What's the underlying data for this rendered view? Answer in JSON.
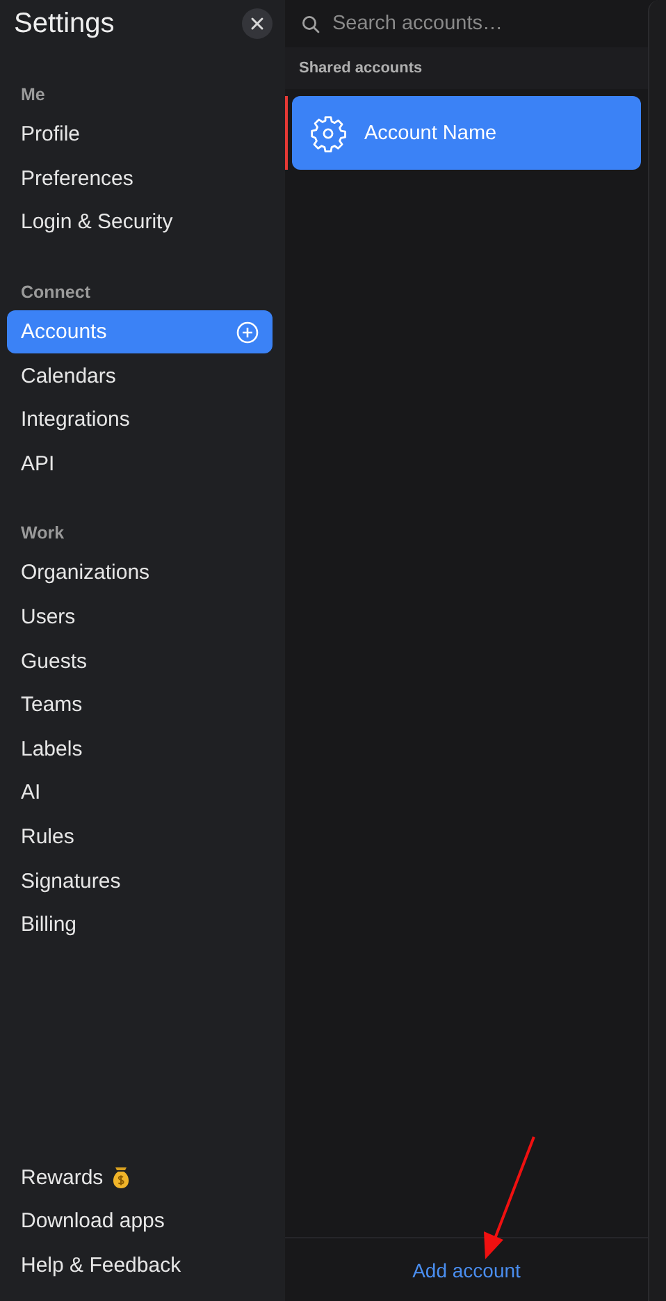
{
  "sidebar": {
    "title": "Settings",
    "sections": [
      {
        "heading": "Me",
        "items": [
          {
            "label": "Profile",
            "selected": false
          },
          {
            "label": "Preferences",
            "selected": false
          },
          {
            "label": "Login & Security",
            "selected": false
          }
        ]
      },
      {
        "heading": "Connect",
        "items": [
          {
            "label": "Accounts",
            "selected": true
          },
          {
            "label": "Calendars",
            "selected": false
          },
          {
            "label": "Integrations",
            "selected": false
          },
          {
            "label": "API",
            "selected": false
          }
        ]
      },
      {
        "heading": "Work",
        "items": [
          {
            "label": "Organizations",
            "selected": false
          },
          {
            "label": "Users",
            "selected": false
          },
          {
            "label": "Guests",
            "selected": false
          },
          {
            "label": "Teams",
            "selected": false
          },
          {
            "label": "Labels",
            "selected": false
          },
          {
            "label": "AI",
            "selected": false
          },
          {
            "label": "Rules",
            "selected": false
          },
          {
            "label": "Signatures",
            "selected": false
          },
          {
            "label": "Billing",
            "selected": false
          }
        ]
      }
    ],
    "footer_items": [
      {
        "label": "Rewards",
        "kind": "rewards"
      },
      {
        "label": "Download apps",
        "kind": "link"
      },
      {
        "label": "Help & Feedback",
        "kind": "link"
      }
    ]
  },
  "accounts_panel": {
    "search": {
      "placeholder": "Search accounts…"
    },
    "group_heading": "Shared accounts",
    "accounts": [
      {
        "name": "Account Name",
        "selected": true
      }
    ],
    "add_button": "Add account"
  }
}
